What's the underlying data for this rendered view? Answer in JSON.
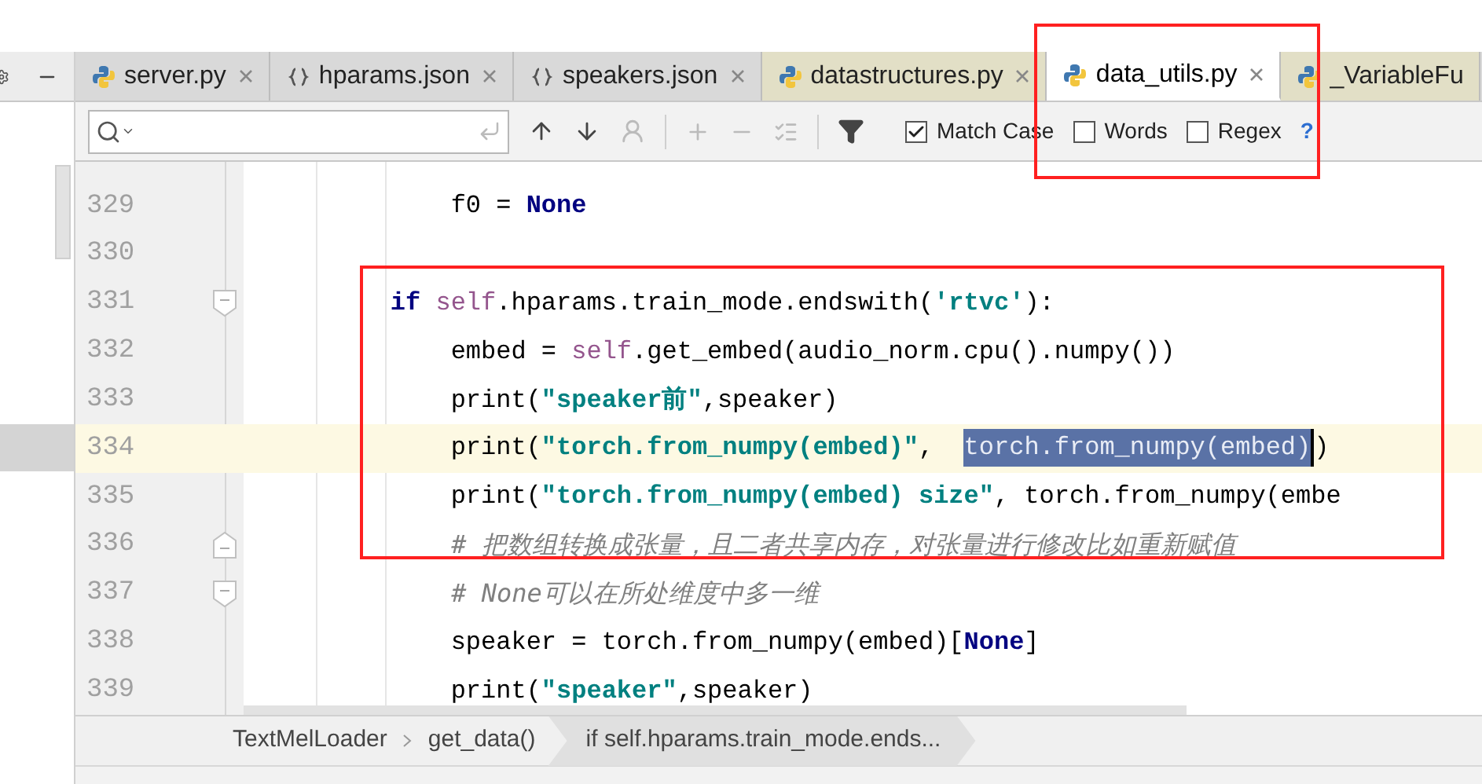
{
  "tabs": [
    {
      "label": "server.py",
      "kind": "python",
      "selected": false,
      "color": "#d9d9d9",
      "closable": true
    },
    {
      "label": "hparams.json",
      "kind": "json",
      "selected": false,
      "color": "#d9d9d9",
      "closable": true
    },
    {
      "label": "speakers.json",
      "kind": "json",
      "selected": false,
      "color": "#d9d9d9",
      "closable": true
    },
    {
      "label": "datastructures.py",
      "kind": "python",
      "selected": false,
      "color": "#e2dfc6",
      "closable": true
    },
    {
      "label": "data_utils.py",
      "kind": "python",
      "selected": true,
      "color": "#ffffff",
      "closable": true
    },
    {
      "label": "_VariableFu",
      "kind": "python",
      "selected": false,
      "color": "#e2dfc6",
      "closable": false
    }
  ],
  "search": {
    "options": [
      {
        "label": "Match Case",
        "checked": true
      },
      {
        "label": "Words",
        "checked": false
      },
      {
        "label": "Regex",
        "checked": false
      }
    ],
    "help": "?"
  },
  "editor": {
    "lines": [
      {
        "number": "329",
        "kind": "line",
        "current": false,
        "tokens": [
          {
            "text": "        f0 = ",
            "kind": "plain"
          },
          {
            "text": "None",
            "kind": "kw"
          }
        ]
      },
      {
        "number": "330",
        "kind": "line",
        "current": false
      },
      {
        "number": "331",
        "kind": "opener",
        "current": false,
        "tokens": [
          {
            "text": "    if ",
            "kind": "kw"
          },
          {
            "text": "self",
            "kind": "self"
          },
          {
            "text": ".hparams.train_mode.endswith(",
            "kind": "plain"
          },
          {
            "text": "'rtvc'",
            "kind": "str"
          },
          {
            "text": "):",
            "kind": "plain"
          }
        ]
      },
      {
        "number": "332",
        "kind": "line",
        "current": false,
        "tokens": [
          {
            "text": "        embed = ",
            "kind": "plain"
          },
          {
            "text": "self",
            "kind": "self"
          },
          {
            "text": ".get_embed(audio_norm.cpu().numpy())",
            "kind": "plain"
          }
        ]
      },
      {
        "number": "333",
        "kind": "line",
        "current": false,
        "tokens": [
          {
            "text": "        print(",
            "kind": "plain"
          },
          {
            "text": "\"speaker前\"",
            "kind": "str"
          },
          {
            "text": ",speaker)",
            "kind": "plain"
          }
        ]
      },
      {
        "number": "334",
        "kind": "line",
        "current": true,
        "tokens": [
          {
            "text": "        print(",
            "kind": "plain"
          },
          {
            "text": "\"torch.from_numpy(embed)\"",
            "kind": "str"
          },
          {
            "text": ",  ",
            "kind": "plain"
          },
          {
            "text": "torch.from_numpy(embed)",
            "kind": "sel"
          },
          {
            "text": ")",
            "kind": "plain"
          }
        ]
      },
      {
        "number": "335",
        "kind": "line",
        "current": false,
        "tokens": [
          {
            "text": "        print(",
            "kind": "plain"
          },
          {
            "text": "\"torch.from_numpy(embed) size\"",
            "kind": "str"
          },
          {
            "text": ", torch.from_numpy(embe",
            "kind": "plain"
          }
        ]
      },
      {
        "number": "336",
        "kind": "closer",
        "current": false,
        "tokens": [
          {
            "text": "        # 把数组转换成张量，且二者共享内存，对张量进行修改比如重新赋值",
            "kind": "comment"
          }
        ]
      },
      {
        "number": "337",
        "kind": "opener",
        "current": false,
        "tokens": [
          {
            "text": "        # None可以在所处维度中多一维",
            "kind": "comment"
          }
        ]
      },
      {
        "number": "338",
        "kind": "line",
        "current": false,
        "tokens": [
          {
            "text": "        speaker = torch.from_numpy(embed)[",
            "kind": "plain"
          },
          {
            "text": "None",
            "kind": "kw"
          },
          {
            "text": "]",
            "kind": "plain"
          }
        ]
      },
      {
        "number": "339",
        "kind": "line",
        "current": false,
        "tokens": [
          {
            "text": "        print(",
            "kind": "plain"
          },
          {
            "text": "\"speaker\"",
            "kind": "str"
          },
          {
            "text": ",speaker)",
            "kind": "plain"
          }
        ]
      }
    ]
  },
  "breadcrumbs": [
    {
      "label": "TextMelLoader",
      "selected": false
    },
    {
      "label": "get_data()",
      "selected": false
    },
    {
      "label": "if self.hparams.train_mode.ends...",
      "selected": true
    }
  ]
}
